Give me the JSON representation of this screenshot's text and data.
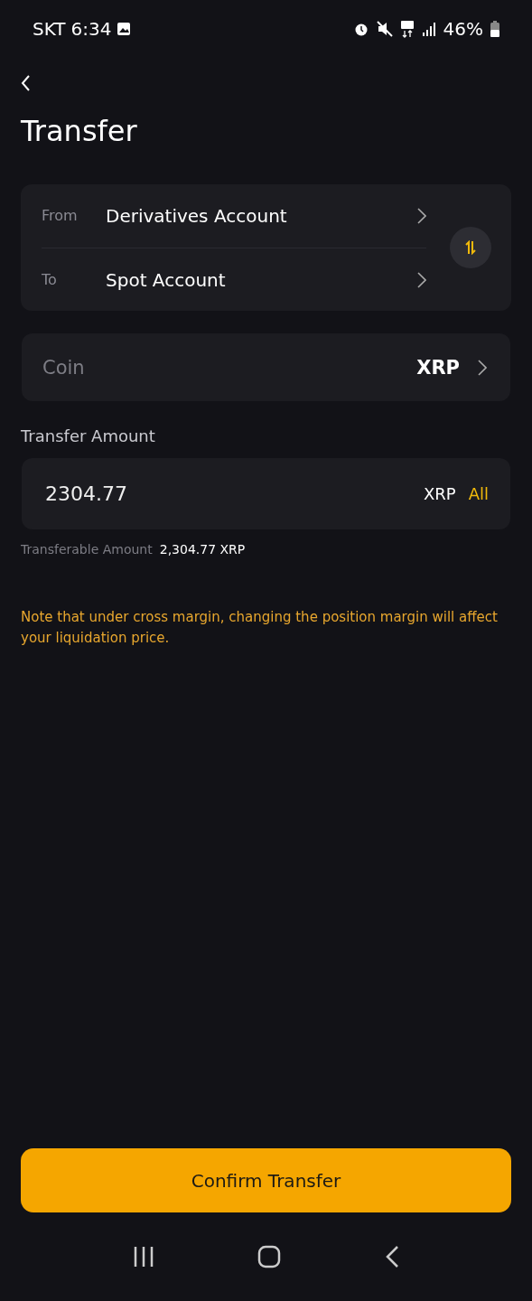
{
  "status_bar": {
    "carrier": "SKT",
    "time": "6:34",
    "battery": "46%"
  },
  "title": "Transfer",
  "accounts": [
    {
      "label": "From",
      "value": "Derivatives Account"
    },
    {
      "label": "To",
      "value": "Spot Account"
    }
  ],
  "coin": {
    "label": "Coin",
    "value": "XRP"
  },
  "amount": {
    "label": "Transfer Amount",
    "value": "2304.77",
    "unit": "XRP",
    "all": "All"
  },
  "transferable": {
    "label": "Transferable Amount",
    "value": "2,304.77 XRP"
  },
  "note": "Note that under cross margin, changing the position margin will affect your liquidation price.",
  "confirm": "Confirm Transfer"
}
